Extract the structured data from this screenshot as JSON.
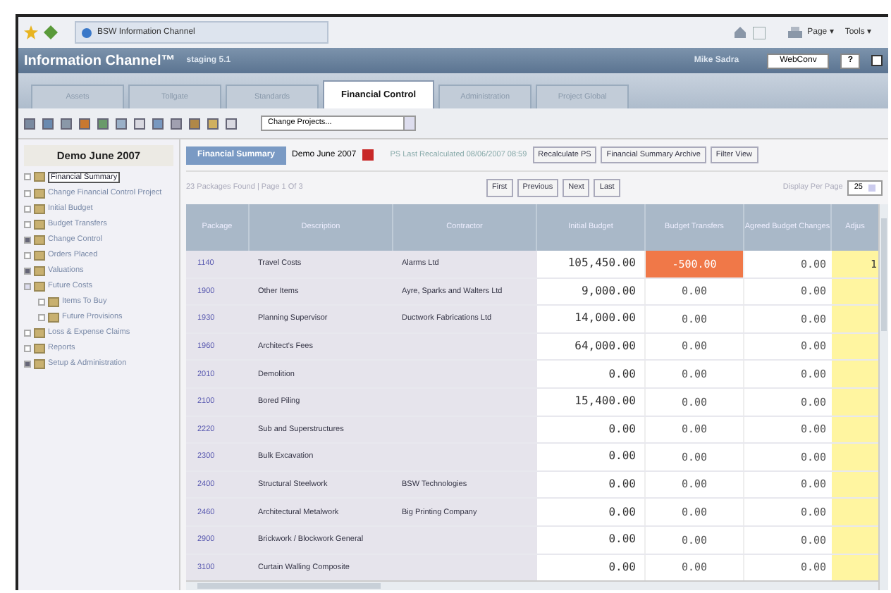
{
  "browser": {
    "tab_title": "BSW Information Channel",
    "menus": [
      "Page ▾",
      "Tools ▾"
    ]
  },
  "header": {
    "title": "Information Channel™",
    "version": "staging 5.1",
    "user": "Mike Sadra",
    "server": "WebConv",
    "help": "?"
  },
  "tabs": [
    {
      "label": "Assets",
      "selected": false
    },
    {
      "label": "Tollgate",
      "selected": false
    },
    {
      "label": "Standards",
      "selected": false
    },
    {
      "label": "Financial Control",
      "selected": true
    },
    {
      "label": "Administration",
      "selected": false
    },
    {
      "label": "Project Global",
      "selected": false
    }
  ],
  "toolbar": {
    "project_select": "Change Projects..."
  },
  "sidebar": {
    "title": "Demo June 2007",
    "items": [
      {
        "label": "Financial Summary",
        "selected": true
      },
      {
        "label": "Change Financial Control Project",
        "selected": false
      },
      {
        "label": "Initial Budget",
        "selected": false
      },
      {
        "label": "Budget Transfers",
        "selected": false
      },
      {
        "label": "Change Control",
        "selected": false,
        "expanded": false
      },
      {
        "label": "Orders Placed",
        "selected": false
      },
      {
        "label": "Valuations",
        "selected": false,
        "expanded": false
      },
      {
        "label": "Future Costs",
        "selected": false,
        "expanded": true,
        "children": [
          {
            "label": "Items To Buy",
            "selected": false
          },
          {
            "label": "Future Provisions",
            "selected": false
          }
        ]
      },
      {
        "label": "Loss & Expense Claims",
        "selected": false
      },
      {
        "label": "Reports",
        "selected": false
      },
      {
        "label": "Setup & Administration",
        "selected": false,
        "expanded": false
      }
    ]
  },
  "summary_bar": {
    "title": "Financial Summary",
    "project": "Demo June 2007",
    "recalc_info": "PS Last Recalculated 08/06/2007 08:59",
    "buttons": [
      "Recalculate PS",
      "Financial Summary Archive",
      "Filter View"
    ]
  },
  "pager": {
    "found": "23 Packages Found | Page 1 Of 3",
    "buttons": [
      "First",
      "Previous",
      "Next",
      "Last"
    ],
    "per_page_label": "Display Per Page",
    "per_page": "25"
  },
  "table": {
    "columns": [
      "Package",
      "Description",
      "Contractor",
      "Initial Budget",
      "Budget Transfers",
      "Agreed Budget Changes",
      "Adjus"
    ],
    "rows": [
      {
        "package": "1140",
        "description": "Travel Costs",
        "contractor": "Alarms Ltd",
        "initial_budget": "105,450.00",
        "budget_transfers": "-500.00",
        "transfer_flagged": true,
        "agreed_changes": "0.00",
        "column_7": "1"
      },
      {
        "package": "1900",
        "description": "Other Items",
        "contractor": "Ayre, Sparks and Walters Ltd",
        "initial_budget": "9,000.00",
        "budget_transfers": "0.00",
        "transfer_flagged": false,
        "agreed_changes": "0.00"
      },
      {
        "package": "1930",
        "description": "Planning Supervisor",
        "contractor": "Ductwork Fabrications Ltd",
        "initial_budget": "14,000.00",
        "budget_transfers": "0.00",
        "transfer_flagged": false,
        "agreed_changes": "0.00"
      },
      {
        "package": "1960",
        "description": "Architect's Fees",
        "initial_budget": "64,000.00",
        "budget_transfers": "0.00",
        "transfer_flagged": false,
        "agreed_changes": "0.00"
      },
      {
        "package": "2010",
        "description": "Demolition",
        "initial_budget": "0.00",
        "budget_transfers": "0.00",
        "transfer_flagged": false,
        "agreed_changes": "0.00"
      },
      {
        "package": "2100",
        "description": "Bored Piling",
        "initial_budget": "15,400.00",
        "budget_transfers": "0.00",
        "transfer_flagged": false,
        "agreed_changes": "0.00"
      },
      {
        "package": "2220",
        "description": "Sub and Superstructures",
        "initial_budget": "0.00",
        "budget_transfers": "0.00",
        "transfer_flagged": false,
        "agreed_changes": "0.00"
      },
      {
        "package": "2300",
        "description": "Bulk Excavation",
        "initial_budget": "0.00",
        "budget_transfers": "0.00",
        "transfer_flagged": false,
        "agreed_changes": "0.00"
      },
      {
        "package": "2400",
        "description": "Structural Steelwork",
        "contractor": "BSW Technologies",
        "initial_budget": "0.00",
        "budget_transfers": "0.00",
        "transfer_flagged": false,
        "agreed_changes": "0.00"
      },
      {
        "package": "2460",
        "description": "Architectural Metalwork",
        "contractor": "Big Printing Company",
        "initial_budget": "0.00",
        "budget_transfers": "0.00",
        "transfer_flagged": false,
        "agreed_changes": "0.00"
      },
      {
        "package": "2900",
        "description": "Brickwork / Blockwork General",
        "initial_budget": "0.00",
        "budget_transfers": "0.00",
        "transfer_flagged": false,
        "agreed_changes": "0.00"
      },
      {
        "package": "3100",
        "description": "Curtain Walling Composite",
        "initial_budget": "0.00",
        "budget_transfers": "0.00",
        "transfer_flagged": false,
        "agreed_changes": "0.00"
      }
    ]
  }
}
